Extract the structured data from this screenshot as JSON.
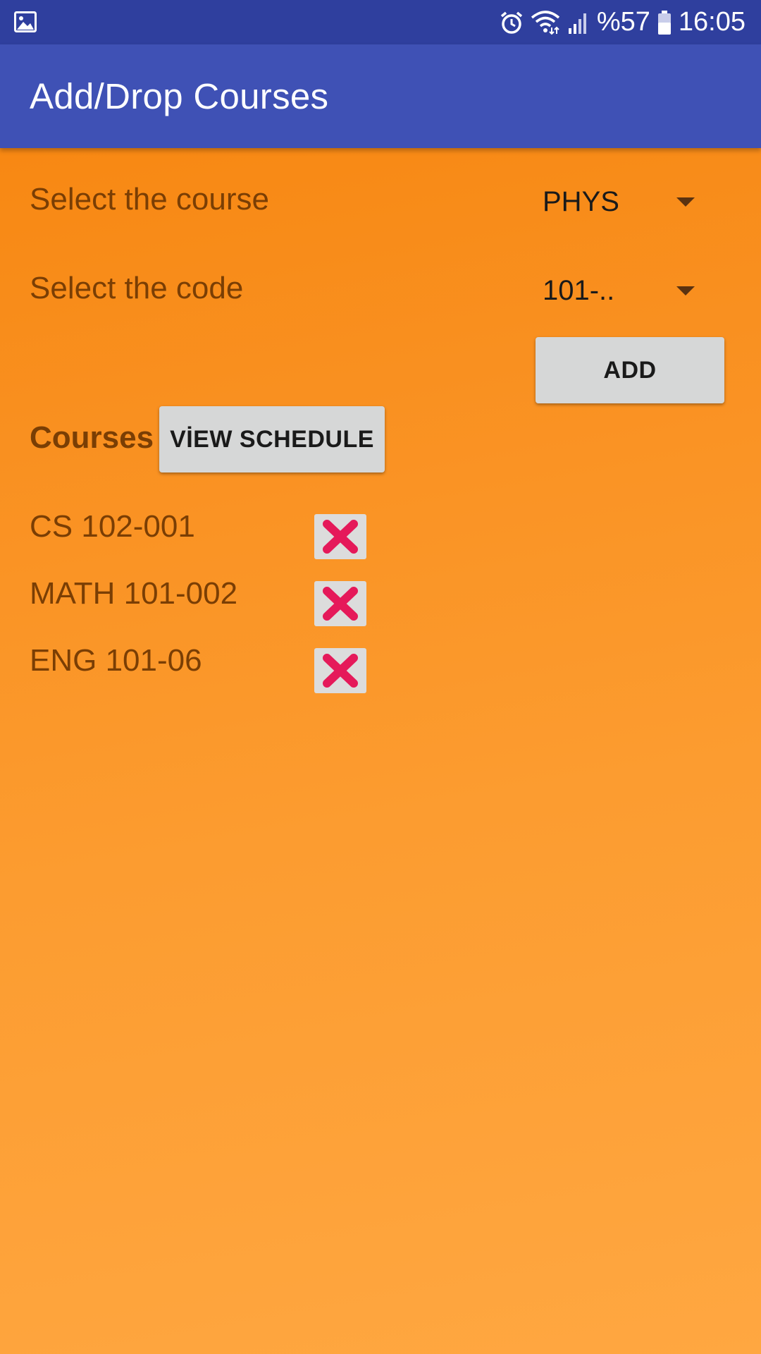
{
  "status_bar": {
    "battery_percent": "%57",
    "time": "16:05",
    "icons": [
      "image-icon",
      "alarm-icon",
      "wifi-icon",
      "signal-icon",
      "battery-icon"
    ]
  },
  "app_bar": {
    "title": "Add/Drop Courses"
  },
  "form": {
    "course_label": "Select the course",
    "course_value": "PHYS",
    "code_label": "Select the code",
    "code_value": "101-..",
    "add_label": "ADD"
  },
  "courses": {
    "heading": "Courses",
    "view_schedule_label": "VİEW SCHEDULE",
    "items": [
      {
        "label": "CS 102-001",
        "remove_icon": "close-icon"
      },
      {
        "label": "MATH 101-002",
        "remove_icon": "close-icon"
      },
      {
        "label": "ENG 101-06",
        "remove_icon": "close-icon"
      }
    ]
  },
  "colors": {
    "status_bar": "#2f3f9e",
    "app_bar": "#3f51b5",
    "background_top": "#f7840c",
    "background_bottom": "#ffa741",
    "label_text": "#7a3e04",
    "remove_icon": "#e5195a"
  }
}
